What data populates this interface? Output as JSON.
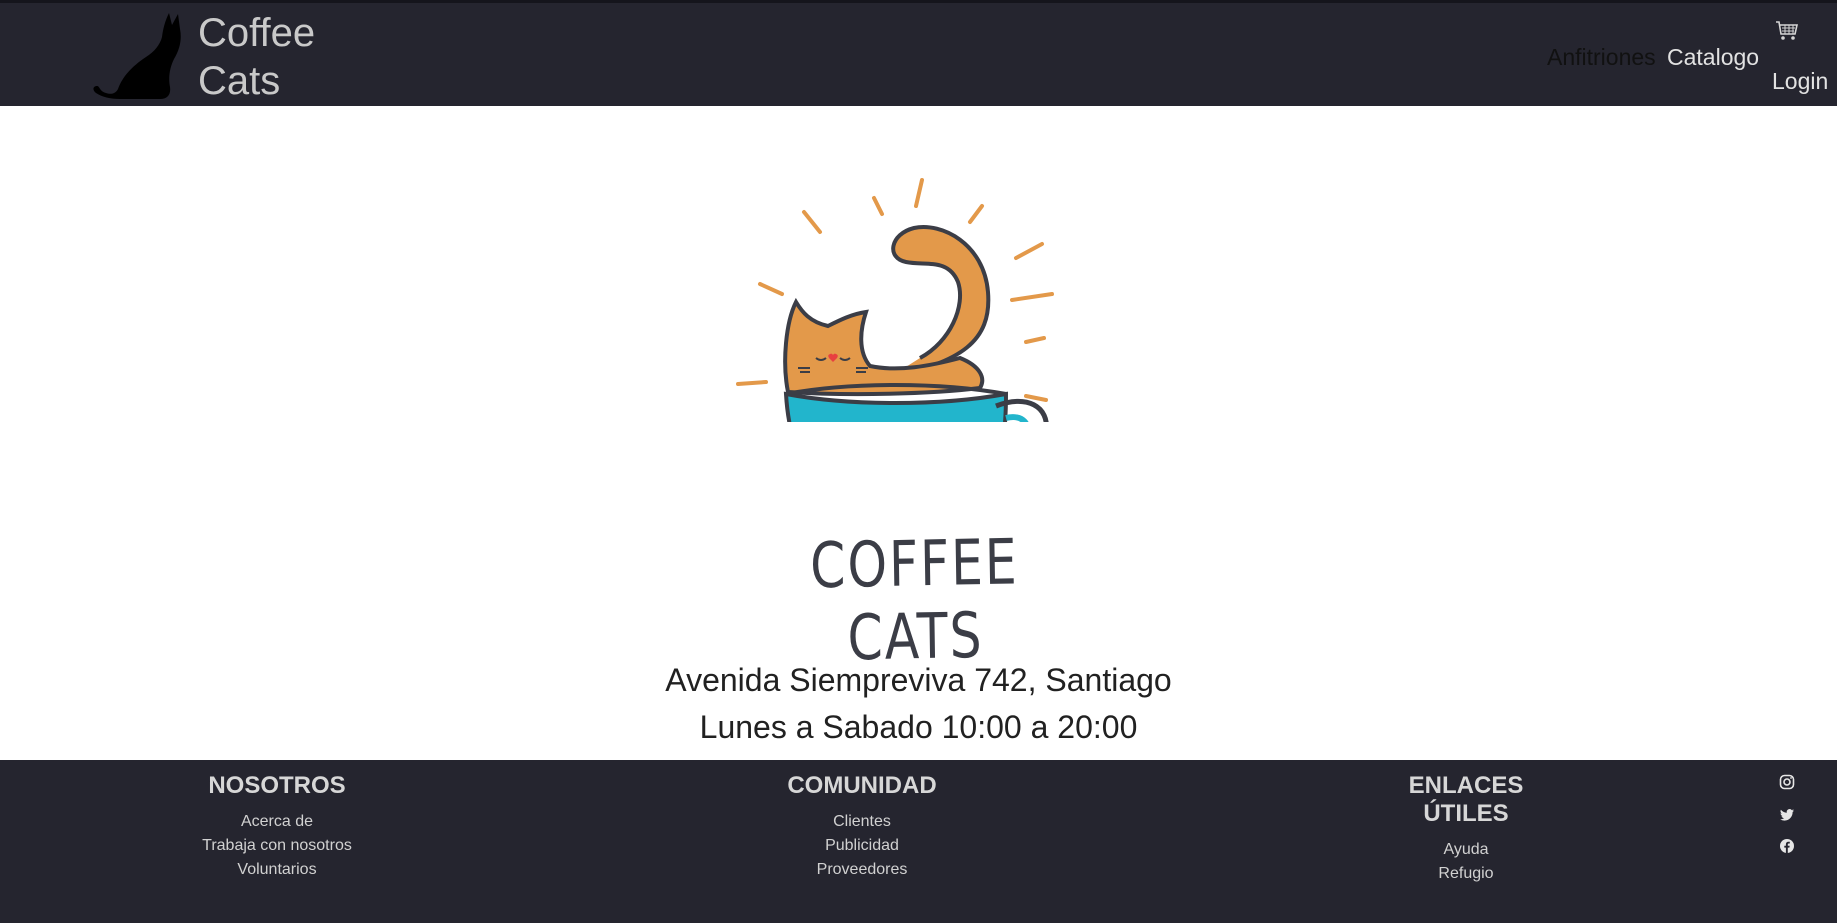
{
  "navbar": {
    "brand_line1": "Coffee",
    "brand_line2": "Cats",
    "links": {
      "anfitriones": "Anfitriones",
      "catalogo": "Catalogo",
      "login": "Login"
    },
    "cart_icon": "shopping-cart-icon"
  },
  "hero": {
    "logo_icon": "cat-in-coffee-cup-logo",
    "wordmark": "COFFEE CATS",
    "address": "Avenida Siempreviva 742, Santiago",
    "hours": "Lunes a Sabado 10:00 a 20:00"
  },
  "footer": {
    "nosotros": {
      "title": "NOSOTROS",
      "links": [
        "Acerca de",
        "Trabaja con nosotros",
        "Voluntarios"
      ]
    },
    "comunidad": {
      "title": "COMUNIDAD",
      "links": [
        "Clientes",
        "Publicidad",
        "Proveedores"
      ]
    },
    "enlaces": {
      "title": "ENLACES ÚTILES",
      "links": [
        "Ayuda",
        "Refugio"
      ]
    },
    "social_icons": [
      "instagram-icon",
      "twitter-icon",
      "facebook-icon"
    ]
  },
  "colors": {
    "navbar_bg": "#25252f",
    "cat_orange": "#e3994a",
    "cup_blue": "#22b5cc",
    "outline": "#3b3d46"
  }
}
